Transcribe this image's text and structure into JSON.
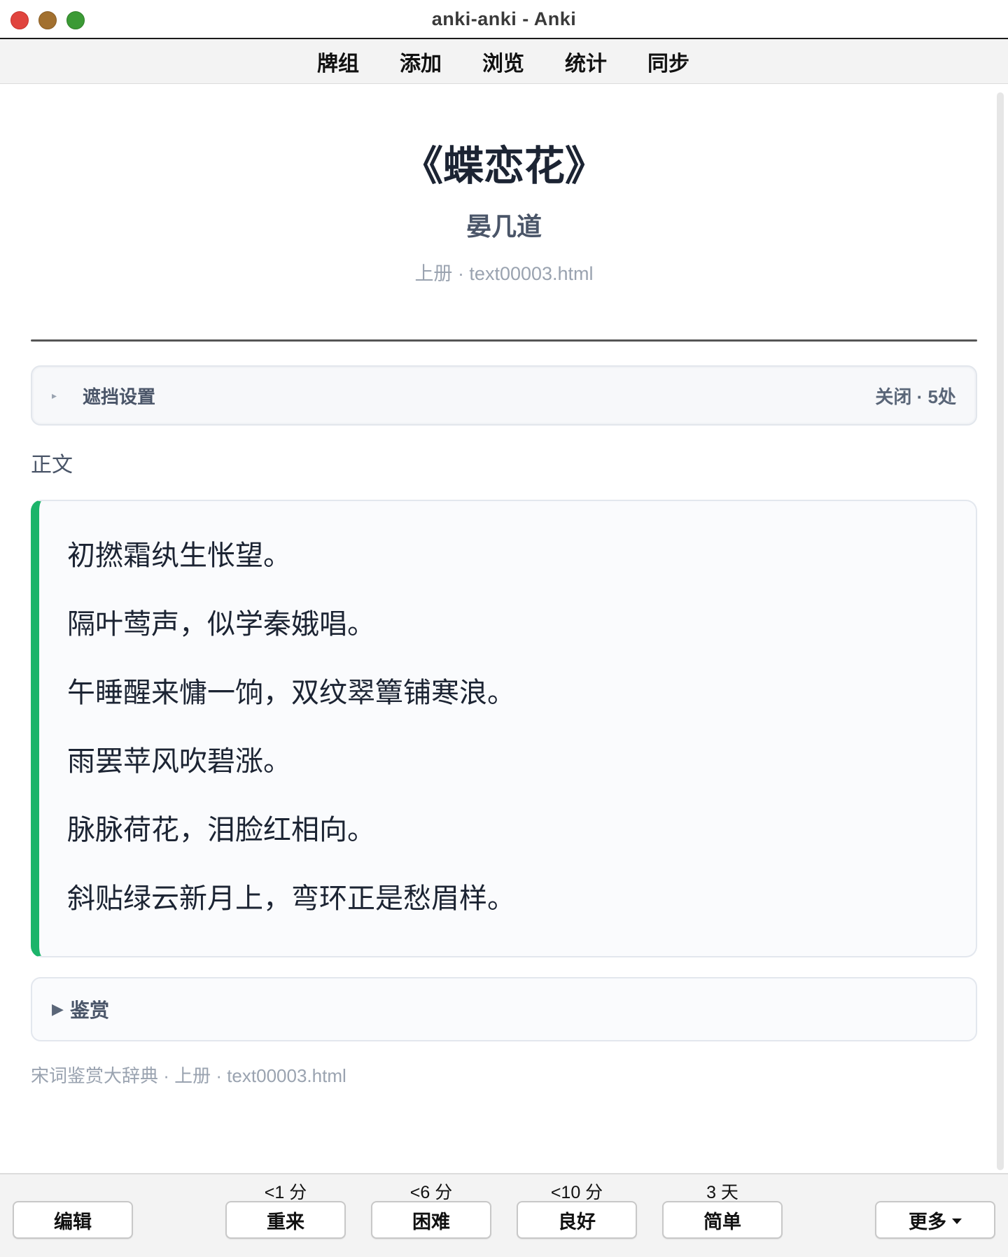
{
  "window": {
    "title": "anki-anki - Anki"
  },
  "menu": {
    "items": [
      {
        "label": "牌组"
      },
      {
        "label": "添加"
      },
      {
        "label": "浏览"
      },
      {
        "label": "统计"
      },
      {
        "label": "同步"
      }
    ]
  },
  "card": {
    "title": "《蝶恋花》",
    "author": "晏几道",
    "source": "上册 · text00003.html",
    "mask": {
      "label": "遮挡设置",
      "status": "关闭 · 5处",
      "caret": "▸"
    },
    "section_label": "正文",
    "poem_lines": [
      "初撚霜纨生怅望。",
      "隔叶莺声，似学秦娥唱。",
      "午睡醒来慵一饷，双纹翠簟铺寒浪。",
      "雨罢苹风吹碧涨。",
      "脉脉荷花，泪脸红相向。",
      "斜贴绿云新月上，弯环正是愁眉样。"
    ],
    "appreciation": {
      "caret": "▶",
      "label": "鉴赏"
    },
    "footer_source": "宋词鉴赏大辞典 · 上册 · text00003.html"
  },
  "bottom": {
    "edit_label": "编辑",
    "more_label": "更多",
    "answers": [
      {
        "interval": "<1 分",
        "label": "重来"
      },
      {
        "interval": "<6 分",
        "label": "困难"
      },
      {
        "interval": "<10 分",
        "label": "良好"
      },
      {
        "interval": "3 天",
        "label": "简单"
      }
    ]
  },
  "colors": {
    "accent_green": "#1cb46a",
    "traffic_red": "#e0443e",
    "traffic_yellow": "#a2702f",
    "traffic_green": "#3b9a35"
  }
}
